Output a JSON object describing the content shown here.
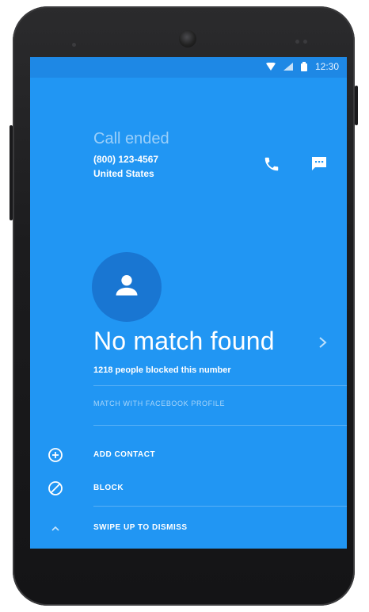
{
  "status_bar": {
    "time": "12:30",
    "icons": [
      "wifi-icon",
      "signal-icon",
      "battery-icon"
    ]
  },
  "call": {
    "status": "Call ended",
    "number": "(800) 123-4567",
    "location": "United States"
  },
  "caller_id": {
    "title": "No match found",
    "blocked_count_text": "1218 people blocked this number",
    "facebook_link": "MATCH WITH FACEBOOK PROFILE"
  },
  "actions": {
    "add_contact": "ADD CONTACT",
    "block": "BLOCK",
    "dismiss": "SWIPE UP TO DISMISS"
  },
  "icons": {
    "call": "phone-icon",
    "message": "message-icon",
    "avatar": "person-icon",
    "add": "plus-circle-icon",
    "block": "block-icon",
    "swipe": "chevron-up-icon",
    "detail": "chevron-right-icon"
  },
  "colors": {
    "screen_bg": "#2196F3",
    "status_bar_bg": "#1E88E5",
    "avatar_bg": "#1976D2",
    "text": "#FFFFFF",
    "phone_body": "#1C1C1E"
  }
}
